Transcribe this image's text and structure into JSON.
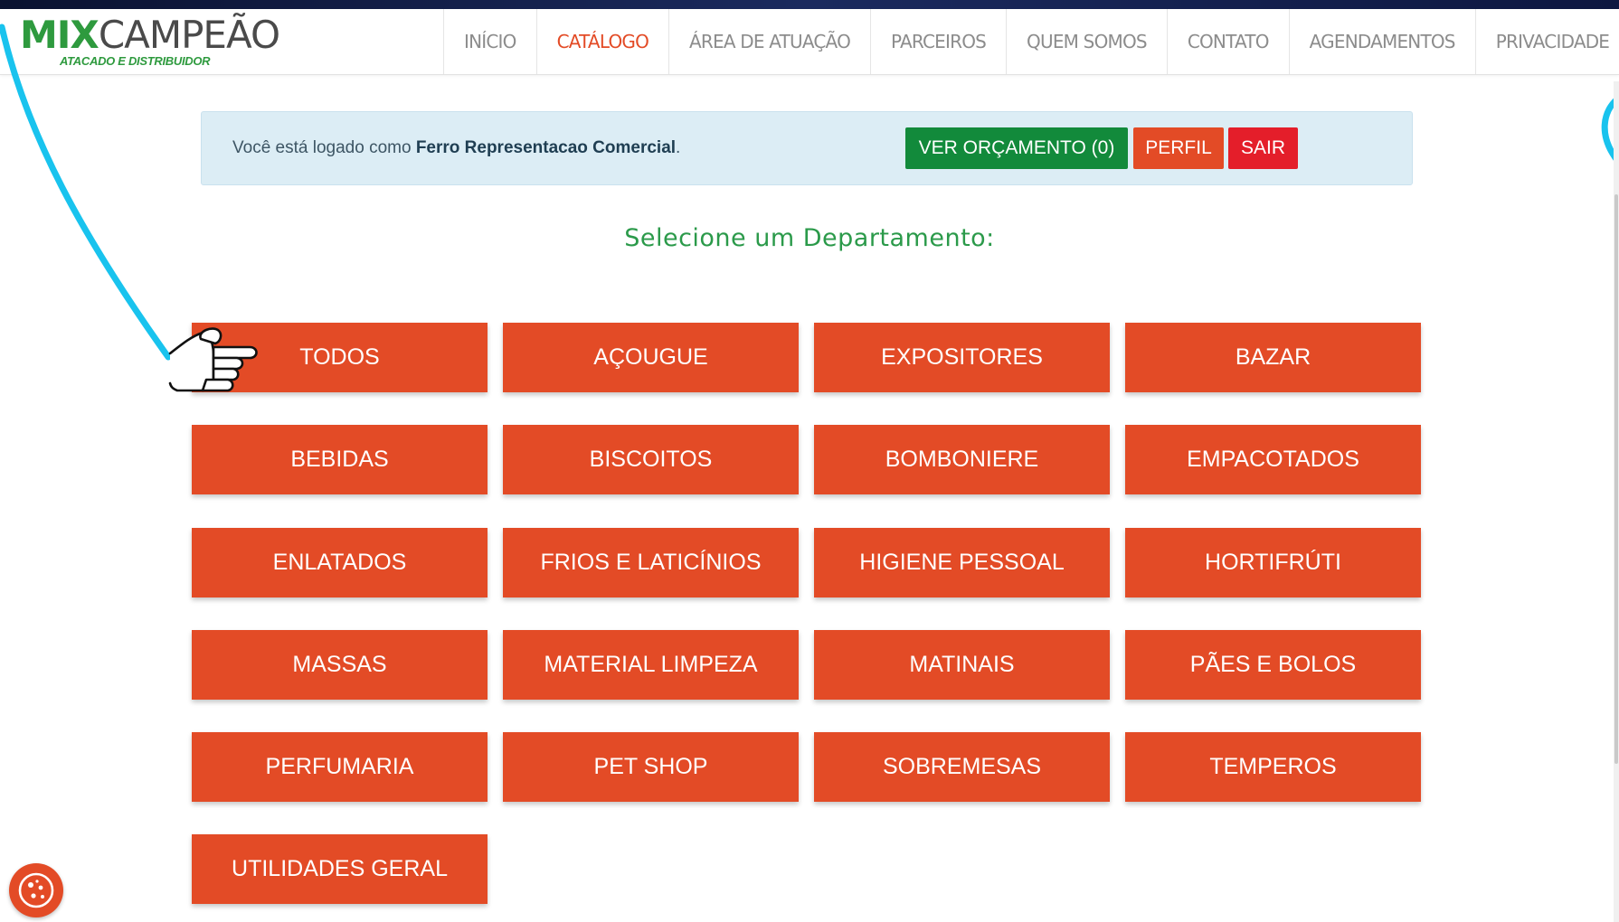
{
  "header": {
    "logo": {
      "main_a": "MIX",
      "main_b": "CAMPEÃO",
      "sub": "ATACADO E DISTRIBUIDOR"
    },
    "nav": [
      "INÍCIO",
      "CATÁLOGO",
      "ÁREA DE ATUAÇÃO",
      "PARCEIROS",
      "QUEM SOMOS",
      "CONTATO",
      "AGENDAMENTOS",
      "PRIVACIDADE"
    ],
    "active_nav": "CATÁLOGO"
  },
  "login_bar": {
    "prefix": "Você está logado como",
    "user": "Ferro Representacao Comercial",
    "suffix": ".",
    "quote_button": "VER ORÇAMENTO (0)",
    "profile_button": "PERFIL",
    "logout_button": "SAIR"
  },
  "main": {
    "title": "Selecione um Departamento:",
    "departments": [
      "TODOS",
      "AÇOUGUE",
      "EXPOSITORES",
      "BAZAR",
      "BEBIDAS",
      "BISCOITOS",
      "BOMBONIERE",
      "EMPACOTADOS",
      "ENLATADOS",
      "FRIOS E LATICÍNIOS",
      "HIGIENE PESSOAL",
      "HORTIFRÚTI",
      "MASSAS",
      "MATERIAL LIMPEZA",
      "MATINAIS",
      "PÃES E BOLOS",
      "PERFUMARIA",
      "PET SHOP",
      "SOBREMESAS",
      "TEMPEROS",
      "UTILIDADES GERAL"
    ]
  },
  "icons": {
    "cookie": "cookie-icon",
    "pointer": "pointing-hand-icon"
  },
  "colors": {
    "accent": "#e34b26",
    "green": "#128a3b",
    "logout": "#e41e2a",
    "annotation": "#19c3ee"
  }
}
